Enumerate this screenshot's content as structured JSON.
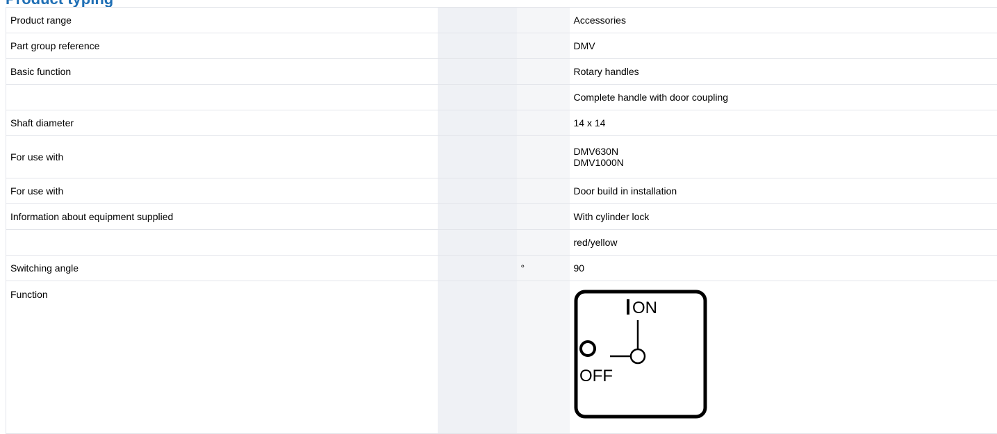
{
  "page": {
    "title": "Product typing"
  },
  "rows": [
    {
      "label": "Product range",
      "unit": "",
      "value": "Accessories"
    },
    {
      "label": "Part group reference",
      "unit": "",
      "value": "DMV"
    },
    {
      "label": "Basic function",
      "unit": "",
      "value": "Rotary handles"
    },
    {
      "label": "",
      "unit": "",
      "value": "Complete handle with door coupling"
    },
    {
      "label": "Shaft diameter",
      "unit": "",
      "value": "14 x 14"
    },
    {
      "label": "For use with",
      "unit": "",
      "values": [
        "DMV630N",
        "DMV1000N"
      ]
    },
    {
      "label": "For use with",
      "unit": "",
      "value": "Door build in installation"
    },
    {
      "label": "Information about equipment supplied",
      "unit": "",
      "value": "With cylinder lock"
    },
    {
      "label": "",
      "unit": "",
      "value": "red/yellow"
    },
    {
      "label": "Switching angle",
      "unit": "°",
      "value": "90"
    },
    {
      "label": "Function",
      "unit": "",
      "diagram": {
        "on_label": "ON",
        "off_label": "OFF",
        "icon": "on-off-switch-diagram"
      }
    }
  ],
  "colors": {
    "title": "#1f6fb5",
    "code_column": "#eff1f5",
    "grid": "#e3e5ea"
  }
}
